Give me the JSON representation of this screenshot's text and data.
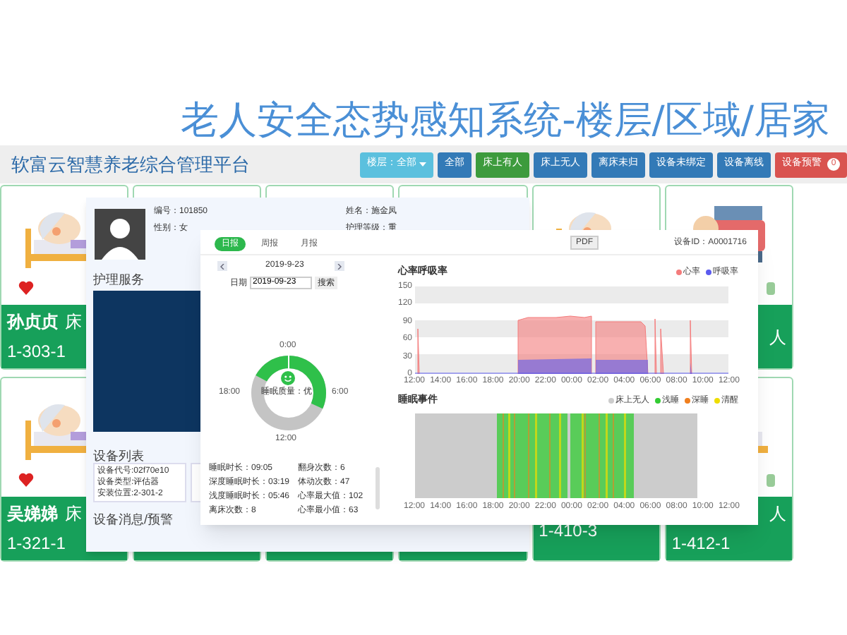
{
  "title": "老人安全态势感知系统-楼层/区域/居家",
  "header": {
    "platform": "软富云智慧养老综合管理平台",
    "buttons": [
      {
        "label": "楼层：全部",
        "kind": "dropdown",
        "color": "#5bc0de"
      },
      {
        "label": "全部",
        "kind": "button",
        "color": "#337ab7"
      },
      {
        "label": "床上有人",
        "kind": "button",
        "color": "#3d9b3d"
      },
      {
        "label": "床上无人",
        "kind": "button",
        "color": "#337ab7"
      },
      {
        "label": "离床未归",
        "kind": "button",
        "color": "#337ab7"
      },
      {
        "label": "设备未绑定",
        "kind": "button",
        "color": "#337ab7"
      },
      {
        "label": "设备离线",
        "kind": "button",
        "color": "#337ab7"
      },
      {
        "label": "设备预警",
        "kind": "badge",
        "color": "#d9534f",
        "count": "0"
      }
    ]
  },
  "cards": [
    {
      "kind": "bed",
      "name": "孙贞贞",
      "status": "床",
      "room": "1-303-1"
    },
    {
      "kind": "bed"
    },
    {
      "kind": "bed"
    },
    {
      "kind": "bed"
    },
    {
      "kind": "bed"
    },
    {
      "kind": "chair",
      "status": "人"
    },
    {
      "kind": "bed",
      "name": "吴娣娣",
      "status": "床",
      "room": "1-321-1"
    },
    {
      "kind": "bed"
    },
    {
      "kind": "bed"
    },
    {
      "kind": "bed"
    },
    {
      "kind": "bed",
      "room": "1-410-3"
    },
    {
      "kind": "bed",
      "status": "人",
      "room": "1-412-1"
    }
  ],
  "patient": {
    "fields": [
      "编号：101850",
      "姓名：施金凤",
      "性别：女",
      "护理等级：重"
    ],
    "sections": [
      "护理服务",
      "设备列表",
      "设备消息/预警"
    ],
    "device": [
      "设备代号:02f70e10",
      "设备类型:评估器",
      "安装位置:2-301-2"
    ]
  },
  "report": {
    "tabs": [
      {
        "label": "日报",
        "selected": true
      },
      {
        "label": "周报",
        "selected": false
      },
      {
        "label": "月报",
        "selected": false
      }
    ],
    "pdf": "PDF",
    "device_id": "设备ID：A0001716",
    "date": "2019-9-23",
    "date_label": "日期",
    "date_value": "2019-09-23",
    "search": "搜索",
    "clock": [
      "0:00",
      "6:00",
      "12:00",
      "18:00"
    ],
    "quality": "睡眠质量：优",
    "stats": [
      "睡眠时长：09:05",
      "翻身次数：6",
      "深度睡眠时长：03:19",
      "体动次数：47",
      "浅度睡眠时长：05:46",
      "心率最大值：102",
      "离床次数：8",
      "心率最小值：63"
    ],
    "heart": {
      "title": "心率呼吸率",
      "legend": [
        {
          "label": "心率",
          "color": "#f47c7c"
        },
        {
          "label": "呼吸率",
          "color": "#5b5bef"
        }
      ],
      "yticks": [
        "150",
        "120",
        "90",
        "60",
        "30",
        "0"
      ]
    },
    "sleep": {
      "title": "睡眠事件",
      "legend": [
        {
          "label": "床上无人",
          "color": "#cccccc"
        },
        {
          "label": "浅睡",
          "color": "#33cc33"
        },
        {
          "label": "深睡",
          "color": "#f07f1e"
        },
        {
          "label": "清醒",
          "color": "#eedd00"
        }
      ]
    },
    "heart_xticks": [
      "12:00",
      "14:00",
      "16:00",
      "18:00",
      "20:00",
      "22:00",
      "00:00",
      "02:00",
      "04:00",
      "06:00",
      "08:00",
      "10:00",
      "12:00"
    ],
    "sleep_xticks": [
      "12:00",
      "14:00",
      "16:00",
      "18:00",
      "20:00",
      "22:00",
      "00:00",
      "02:00",
      "04:00",
      "06:00",
      "08:00",
      "10:00",
      "12:00"
    ]
  }
}
